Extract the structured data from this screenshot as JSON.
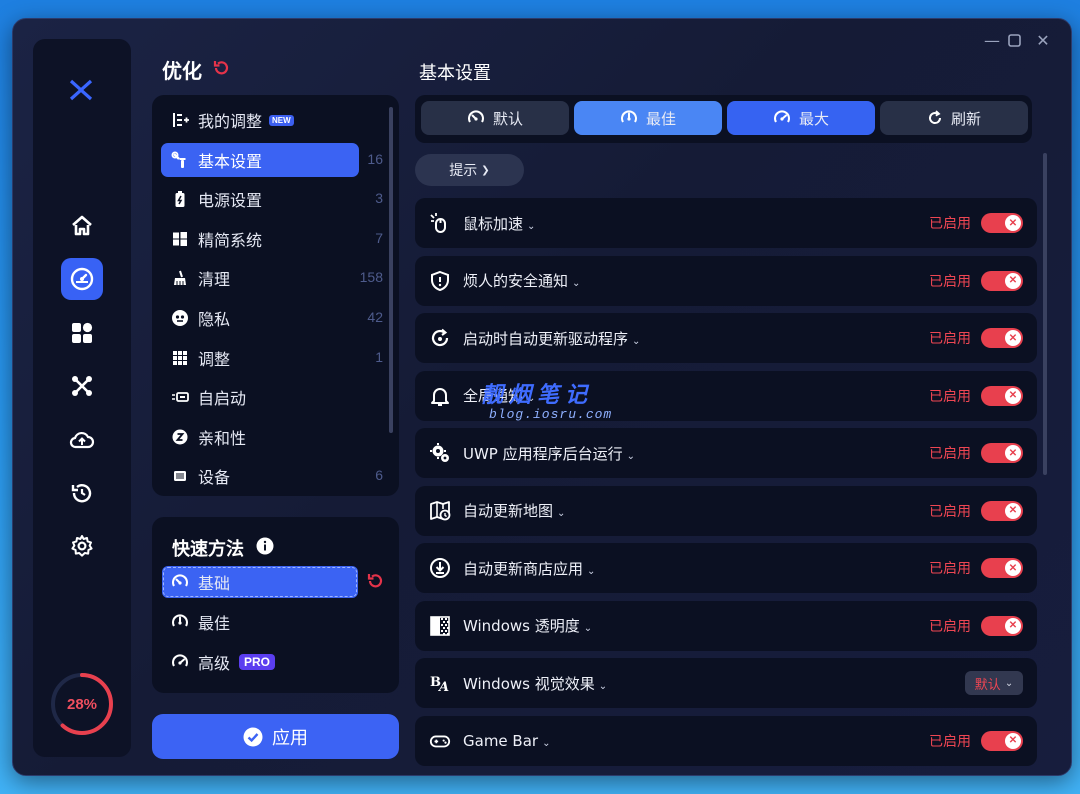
{
  "window": {
    "controls": {
      "minimize": "—",
      "maximize": "☐",
      "close": "✕"
    }
  },
  "rail": {
    "logo_icon": "x-logo-icon",
    "items": [
      {
        "icon": "home-icon",
        "active": false
      },
      {
        "icon": "gauge-icon",
        "active": true
      },
      {
        "icon": "grid-icon",
        "active": false
      },
      {
        "icon": "connect-icon",
        "active": false
      },
      {
        "icon": "cloud-upload-icon",
        "active": false
      },
      {
        "icon": "history-icon",
        "active": false
      },
      {
        "icon": "gear-icon",
        "active": false
      }
    ],
    "progress": {
      "text": "28%",
      "value": 0.28
    }
  },
  "optimize": {
    "title": "优化",
    "nav": [
      {
        "label": "我的调整",
        "badge": "NEW",
        "count": "",
        "icon": "my-tweaks-icon"
      },
      {
        "label": "基本设置",
        "count": "16",
        "active": true,
        "icon": "tools-icon"
      },
      {
        "label": "电源设置",
        "count": "3",
        "icon": "battery-icon"
      },
      {
        "label": "精简系统",
        "count": "7",
        "icon": "windows-icon"
      },
      {
        "label": "清理",
        "count": "158",
        "icon": "broom-icon"
      },
      {
        "label": "隐私",
        "count": "42",
        "icon": "privacy-icon"
      },
      {
        "label": "调整",
        "count": "1",
        "icon": "dots-grid-icon"
      },
      {
        "label": "自启动",
        "count": "",
        "icon": "startup-icon"
      },
      {
        "label": "亲和性",
        "count": "",
        "icon": "affinity-icon"
      },
      {
        "label": "设备",
        "count": "6",
        "icon": "chip-icon"
      }
    ]
  },
  "quick": {
    "title": "快速方法",
    "info_icon": "info-icon",
    "items": [
      {
        "label": "基础",
        "active": true,
        "icon": "gauge-low-icon"
      },
      {
        "label": "最佳",
        "icon": "gauge-mid-icon"
      },
      {
        "label": "高级",
        "badge": "PRO",
        "icon": "gauge-high-icon"
      }
    ]
  },
  "apply": {
    "label": "应用"
  },
  "main": {
    "title": "基本设置",
    "modes": [
      {
        "label": "默认",
        "icon": "gauge-low-icon"
      },
      {
        "label": "最佳",
        "icon": "gauge-mid-icon"
      },
      {
        "label": "最大",
        "icon": "gauge-high-icon"
      },
      {
        "label": "刷新",
        "icon": "refresh-icon"
      }
    ],
    "tip": {
      "label": "提示"
    },
    "settings": [
      {
        "label": "鼠标加速",
        "status": "已启用",
        "icon": "mouse-icon",
        "type": "toggle"
      },
      {
        "label": "烦人的安全通知",
        "status": "已启用",
        "icon": "shield-icon",
        "type": "toggle"
      },
      {
        "label": "启动时自动更新驱动程序",
        "status": "已启用",
        "icon": "driver-update-icon",
        "type": "toggle"
      },
      {
        "label": "全局通知",
        "status": "已启用",
        "icon": "bell-icon",
        "type": "toggle"
      },
      {
        "label": "UWP 应用程序后台运行",
        "status": "已启用",
        "icon": "gears-icon",
        "type": "toggle"
      },
      {
        "label": "自动更新地图",
        "status": "已启用",
        "icon": "map-icon",
        "type": "toggle"
      },
      {
        "label": "自动更新商店应用",
        "status": "已启用",
        "icon": "download-circle-icon",
        "type": "toggle"
      },
      {
        "label": "Windows 透明度",
        "status": "已启用",
        "icon": "transparency-icon",
        "type": "toggle"
      },
      {
        "label": "Windows 视觉效果",
        "status": "默认",
        "icon": "visual-effects-icon",
        "type": "select"
      },
      {
        "label": "Game Bar",
        "status": "已启用",
        "icon": "gamepad-icon",
        "type": "toggle"
      }
    ]
  },
  "watermark": {
    "cn": "靓烟笔记",
    "url": "blog.iosru.com"
  },
  "colors": {
    "accent": "#3b63f3",
    "enabled": "#ee4653",
    "panel": "#0b1022"
  }
}
